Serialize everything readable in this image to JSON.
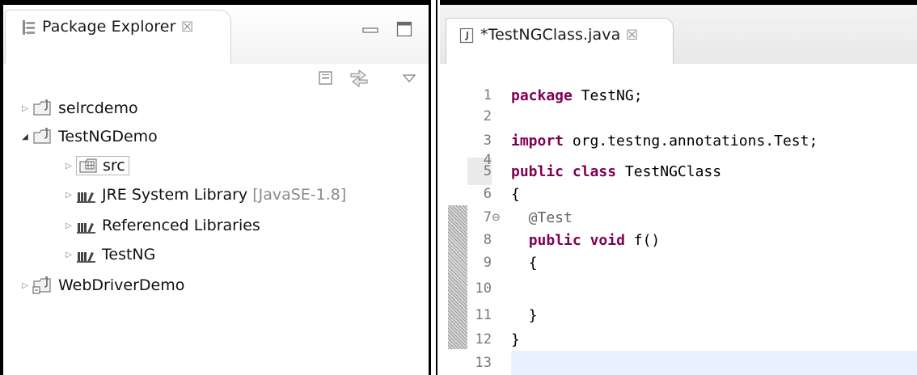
{
  "left_panel": {
    "title": "Package Explorer",
    "title_icon": "package-explorer-icon",
    "close_glyph": "☒",
    "controls": {
      "minimize_icon": "minimize-icon",
      "maximize_icon": "maximize-icon",
      "collapse_all_icon": "collapse-all-icon",
      "link_editor_icon": "link-with-editor-icon",
      "view_menu_icon": "view-menu-icon"
    },
    "tree": [
      {
        "label": "selrcdemo",
        "decoration": "",
        "icon": "java-project-icon",
        "expanded": false
      },
      {
        "label": "TestNGDemo",
        "decoration": "",
        "icon": "java-project-icon",
        "expanded": true
      },
      {
        "label": "src",
        "decoration": "",
        "icon": "source-folder-icon",
        "expanded": false,
        "selected": true
      },
      {
        "label": "JRE System Library",
        "decoration": "[JavaSE-1.8]",
        "icon": "library-icon",
        "expanded": false
      },
      {
        "label": "Referenced Libraries",
        "decoration": "",
        "icon": "library-icon",
        "expanded": false
      },
      {
        "label": "TestNG",
        "decoration": "",
        "icon": "library-icon",
        "expanded": false
      },
      {
        "label": "WebDriverDemo",
        "decoration": "",
        "icon": "java-project-icon",
        "expanded": false
      }
    ]
  },
  "editor": {
    "tab_title": "*TestNGClass.java",
    "tab_icon": "java-file-icon",
    "close_glyph": "☒",
    "fold_glyph": "⊖",
    "lines": [
      {
        "num": "1",
        "text": "package TestNG;"
      },
      {
        "num": "2",
        "text": ""
      },
      {
        "num": "3",
        "text": "import org.testng.annotations.Test;"
      },
      {
        "num": "4",
        "text": ""
      },
      {
        "num": "5",
        "text": "public class TestNGClass"
      },
      {
        "num": "6",
        "text": "{"
      },
      {
        "num": "7",
        "text": "  @Test"
      },
      {
        "num": "8",
        "text": "  public void f()"
      },
      {
        "num": "9",
        "text": "  {"
      },
      {
        "num": "10",
        "text": ""
      },
      {
        "num": "11",
        "text": "  }"
      },
      {
        "num": "12",
        "text": "}"
      },
      {
        "num": "13",
        "text": ""
      }
    ]
  },
  "colors": {
    "keyword": "#7f0055",
    "annotation": "#646464",
    "line_number": "#787878"
  }
}
